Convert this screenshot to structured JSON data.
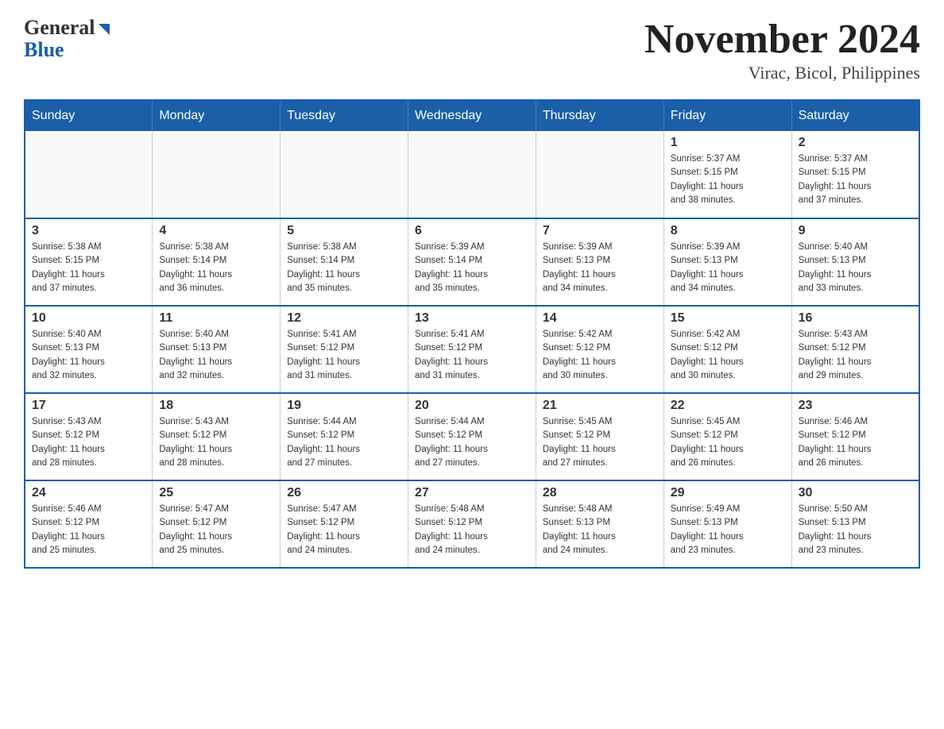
{
  "logo": {
    "general": "General",
    "blue": "Blue"
  },
  "header": {
    "month_title": "November 2024",
    "location": "Virac, Bicol, Philippines"
  },
  "weekdays": [
    "Sunday",
    "Monday",
    "Tuesday",
    "Wednesday",
    "Thursday",
    "Friday",
    "Saturday"
  ],
  "weeks": [
    [
      {
        "day": "",
        "info": ""
      },
      {
        "day": "",
        "info": ""
      },
      {
        "day": "",
        "info": ""
      },
      {
        "day": "",
        "info": ""
      },
      {
        "day": "",
        "info": ""
      },
      {
        "day": "1",
        "info": "Sunrise: 5:37 AM\nSunset: 5:15 PM\nDaylight: 11 hours\nand 38 minutes."
      },
      {
        "day": "2",
        "info": "Sunrise: 5:37 AM\nSunset: 5:15 PM\nDaylight: 11 hours\nand 37 minutes."
      }
    ],
    [
      {
        "day": "3",
        "info": "Sunrise: 5:38 AM\nSunset: 5:15 PM\nDaylight: 11 hours\nand 37 minutes."
      },
      {
        "day": "4",
        "info": "Sunrise: 5:38 AM\nSunset: 5:14 PM\nDaylight: 11 hours\nand 36 minutes."
      },
      {
        "day": "5",
        "info": "Sunrise: 5:38 AM\nSunset: 5:14 PM\nDaylight: 11 hours\nand 35 minutes."
      },
      {
        "day": "6",
        "info": "Sunrise: 5:39 AM\nSunset: 5:14 PM\nDaylight: 11 hours\nand 35 minutes."
      },
      {
        "day": "7",
        "info": "Sunrise: 5:39 AM\nSunset: 5:13 PM\nDaylight: 11 hours\nand 34 minutes."
      },
      {
        "day": "8",
        "info": "Sunrise: 5:39 AM\nSunset: 5:13 PM\nDaylight: 11 hours\nand 34 minutes."
      },
      {
        "day": "9",
        "info": "Sunrise: 5:40 AM\nSunset: 5:13 PM\nDaylight: 11 hours\nand 33 minutes."
      }
    ],
    [
      {
        "day": "10",
        "info": "Sunrise: 5:40 AM\nSunset: 5:13 PM\nDaylight: 11 hours\nand 32 minutes."
      },
      {
        "day": "11",
        "info": "Sunrise: 5:40 AM\nSunset: 5:13 PM\nDaylight: 11 hours\nand 32 minutes."
      },
      {
        "day": "12",
        "info": "Sunrise: 5:41 AM\nSunset: 5:12 PM\nDaylight: 11 hours\nand 31 minutes."
      },
      {
        "day": "13",
        "info": "Sunrise: 5:41 AM\nSunset: 5:12 PM\nDaylight: 11 hours\nand 31 minutes."
      },
      {
        "day": "14",
        "info": "Sunrise: 5:42 AM\nSunset: 5:12 PM\nDaylight: 11 hours\nand 30 minutes."
      },
      {
        "day": "15",
        "info": "Sunrise: 5:42 AM\nSunset: 5:12 PM\nDaylight: 11 hours\nand 30 minutes."
      },
      {
        "day": "16",
        "info": "Sunrise: 5:43 AM\nSunset: 5:12 PM\nDaylight: 11 hours\nand 29 minutes."
      }
    ],
    [
      {
        "day": "17",
        "info": "Sunrise: 5:43 AM\nSunset: 5:12 PM\nDaylight: 11 hours\nand 28 minutes."
      },
      {
        "day": "18",
        "info": "Sunrise: 5:43 AM\nSunset: 5:12 PM\nDaylight: 11 hours\nand 28 minutes."
      },
      {
        "day": "19",
        "info": "Sunrise: 5:44 AM\nSunset: 5:12 PM\nDaylight: 11 hours\nand 27 minutes."
      },
      {
        "day": "20",
        "info": "Sunrise: 5:44 AM\nSunset: 5:12 PM\nDaylight: 11 hours\nand 27 minutes."
      },
      {
        "day": "21",
        "info": "Sunrise: 5:45 AM\nSunset: 5:12 PM\nDaylight: 11 hours\nand 27 minutes."
      },
      {
        "day": "22",
        "info": "Sunrise: 5:45 AM\nSunset: 5:12 PM\nDaylight: 11 hours\nand 26 minutes."
      },
      {
        "day": "23",
        "info": "Sunrise: 5:46 AM\nSunset: 5:12 PM\nDaylight: 11 hours\nand 26 minutes."
      }
    ],
    [
      {
        "day": "24",
        "info": "Sunrise: 5:46 AM\nSunset: 5:12 PM\nDaylight: 11 hours\nand 25 minutes."
      },
      {
        "day": "25",
        "info": "Sunrise: 5:47 AM\nSunset: 5:12 PM\nDaylight: 11 hours\nand 25 minutes."
      },
      {
        "day": "26",
        "info": "Sunrise: 5:47 AM\nSunset: 5:12 PM\nDaylight: 11 hours\nand 24 minutes."
      },
      {
        "day": "27",
        "info": "Sunrise: 5:48 AM\nSunset: 5:12 PM\nDaylight: 11 hours\nand 24 minutes."
      },
      {
        "day": "28",
        "info": "Sunrise: 5:48 AM\nSunset: 5:13 PM\nDaylight: 11 hours\nand 24 minutes."
      },
      {
        "day": "29",
        "info": "Sunrise: 5:49 AM\nSunset: 5:13 PM\nDaylight: 11 hours\nand 23 minutes."
      },
      {
        "day": "30",
        "info": "Sunrise: 5:50 AM\nSunset: 5:13 PM\nDaylight: 11 hours\nand 23 minutes."
      }
    ]
  ]
}
